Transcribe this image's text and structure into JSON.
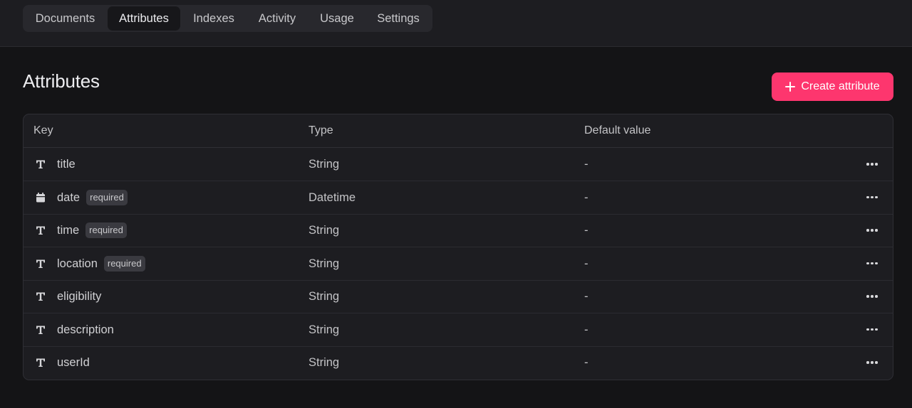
{
  "tabs": [
    {
      "label": "Documents",
      "active": false
    },
    {
      "label": "Attributes",
      "active": true
    },
    {
      "label": "Indexes",
      "active": false
    },
    {
      "label": "Activity",
      "active": false
    },
    {
      "label": "Usage",
      "active": false
    },
    {
      "label": "Settings",
      "active": false
    }
  ],
  "page": {
    "title": "Attributes",
    "create_button_label": "Create attribute"
  },
  "table": {
    "columns": [
      "Key",
      "Type",
      "Default value"
    ],
    "rows": [
      {
        "key": "title",
        "icon": "text-type-icon",
        "required": false,
        "badge": "",
        "type": "String",
        "default": "-"
      },
      {
        "key": "date",
        "icon": "calendar-icon",
        "required": true,
        "badge": "required",
        "type": "Datetime",
        "default": "-"
      },
      {
        "key": "time",
        "icon": "text-type-icon",
        "required": true,
        "badge": "required",
        "type": "String",
        "default": "-"
      },
      {
        "key": "location",
        "icon": "text-type-icon",
        "required": true,
        "badge": "required",
        "type": "String",
        "default": "-"
      },
      {
        "key": "eligibility",
        "icon": "text-type-icon",
        "required": false,
        "badge": "",
        "type": "String",
        "default": "-"
      },
      {
        "key": "description",
        "icon": "text-type-icon",
        "required": false,
        "badge": "",
        "type": "String",
        "default": "-"
      },
      {
        "key": "userId",
        "icon": "text-type-icon",
        "required": false,
        "badge": "",
        "type": "String",
        "default": "-"
      }
    ]
  },
  "colors": {
    "accent": "#fd366e",
    "background": "#141416",
    "panel": "#1d1d21"
  }
}
